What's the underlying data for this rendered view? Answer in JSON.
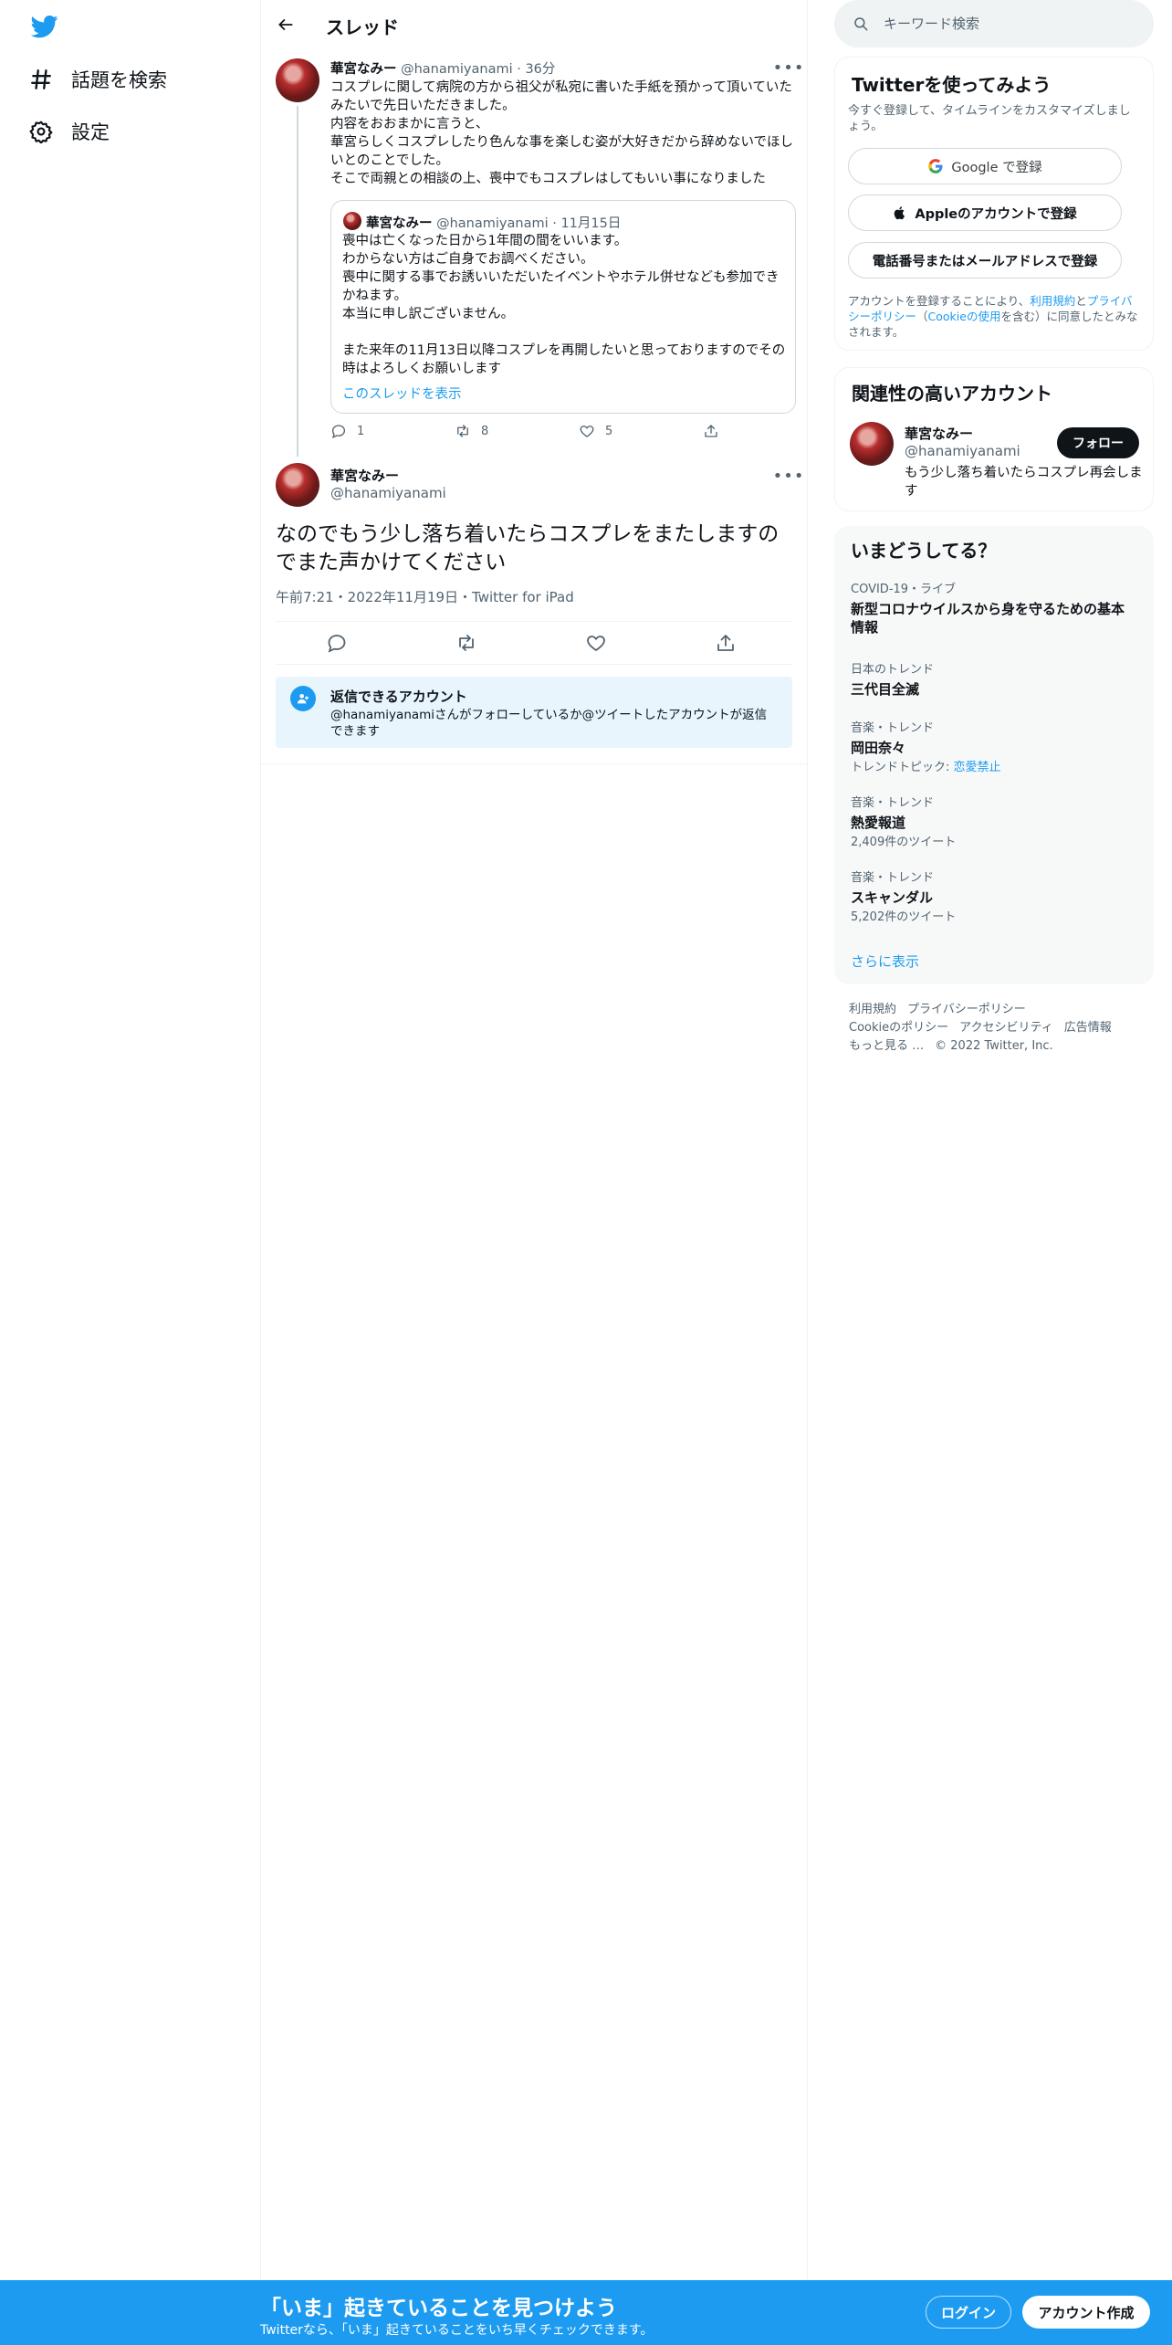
{
  "colors": {
    "brand": "#1d9bf0",
    "text": "#0f1419",
    "muted": "#536471",
    "border": "#eff3f4"
  },
  "nav": {
    "logo_icon": "twitter-bird-icon",
    "items": [
      {
        "icon": "hashtag-icon",
        "label": "話題を検索"
      },
      {
        "icon": "gear-icon",
        "label": "設定"
      }
    ]
  },
  "header": {
    "title": "スレッド",
    "back_icon": "arrow-left-icon"
  },
  "tweet1": {
    "name": "華宮なみー",
    "handle": "@hanamiyanami",
    "time": "36分",
    "body": "コスプレに関して病院の方から祖父が私宛に書いた手紙を預かって頂いていたみたいで先日いただきました。\n内容をおおまかに言うと、\n華宮らしくコスプレしたり色んな事を楽しむ姿が大好きだから辞めないでほしいとのことでした。\nそこで両親との相談の上、喪中でもコスプレはしてもいい事になりました",
    "quote": {
      "name": "華宮なみー",
      "handle": "@hanamiyanami",
      "date": "11月15日",
      "body": "喪中は亡くなった日から1年間の間をいいます。\nわからない方はご自身でお調べください。\n喪中に関する事でお誘いいただいたイベントやホテル併せなども参加できかねます。\n本当に申し訳ございません。\n\nまた来年の11月13日以降コスプレを再開したいと思っておりますのでその時はよろしくお願いします",
      "link": "このスレッドを表示"
    },
    "stats": {
      "replies": "1",
      "retweets": "8",
      "likes": "5"
    }
  },
  "tweet2": {
    "name": "華宮なみー",
    "handle": "@hanamiyanami",
    "text": "なのでもう少し落ち着いたらコスプレをまたしますのでまた声かけてください",
    "meta": "午前7:21・2022年11月19日・Twitter for iPad"
  },
  "reply_notice": {
    "title": "返信できるアカウント",
    "desc": "@hanamiyanamiさんがフォローしているか@ツイートしたアカウントが返信できます"
  },
  "search": {
    "placeholder": "キーワード検索"
  },
  "signup": {
    "title": "Twitterを使ってみよう",
    "sub": "今すぐ登録して、タイムラインをカスタマイズしましょう。",
    "google": "Google で登録",
    "apple": "Appleのアカウントで登録",
    "phone": "電話番号またはメールアドレスで登録",
    "terms_pre": "アカウントを登録することにより、",
    "terms_link1": "利用規約",
    "terms_mid1": "と",
    "terms_link2": "プライバシーポリシー",
    "terms_mid2": "（",
    "terms_link3": "Cookieの使用",
    "terms_post": "を含む）に同意したとみなされます。"
  },
  "related": {
    "title": "関連性の高いアカウント",
    "name": "華宮なみー",
    "handle": "@hanamiyanami",
    "follow": "フォロー",
    "bio": "もう少し落ち着いたらコスプレ再会します"
  },
  "trends": {
    "title": "いまどうしてる？",
    "items": [
      {
        "cat": "COVID-19・ライブ",
        "title": "新型コロナウイルスから身を守るための基本情報",
        "extra": ""
      },
      {
        "cat": "日本のトレンド",
        "title": "三代目全滅",
        "extra": ""
      },
      {
        "cat": "音楽・トレンド",
        "title": "岡田奈々",
        "extra_pre": "トレンドトピック: ",
        "extra_link": "恋愛禁止"
      },
      {
        "cat": "音楽・トレンド",
        "title": "熱愛報道",
        "extra": "2,409件のツイート"
      },
      {
        "cat": "音楽・トレンド",
        "title": "スキャンダル",
        "extra": "5,202件のツイート"
      }
    ],
    "more": "さらに表示"
  },
  "footer": {
    "links": [
      "利用規約",
      "プライバシーポリシー",
      "Cookieのポリシー",
      "アクセシビリティ",
      "広告情報",
      "もっと見る …"
    ],
    "copyright": "© 2022 Twitter, Inc."
  },
  "banner": {
    "title": "「いま」起きていることを見つけよう",
    "sub": "Twitterなら、「いま」起きていることをいち早くチェックできます。",
    "login": "ログイン",
    "signup": "アカウント作成"
  }
}
